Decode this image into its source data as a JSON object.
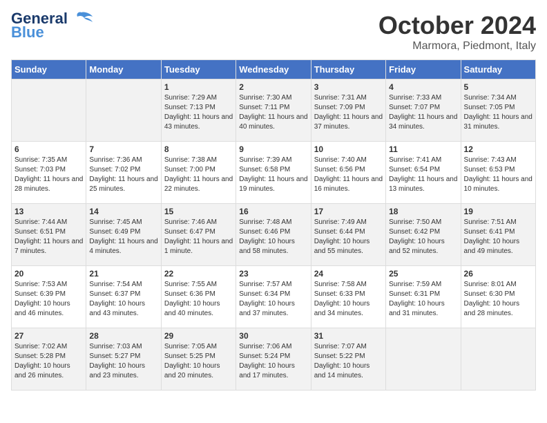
{
  "header": {
    "logo_general": "General",
    "logo_blue": "Blue",
    "month_title": "October 2024",
    "subtitle": "Marmora, Piedmont, Italy"
  },
  "weekdays": [
    "Sunday",
    "Monday",
    "Tuesday",
    "Wednesday",
    "Thursday",
    "Friday",
    "Saturday"
  ],
  "weeks": [
    [
      {
        "day": "",
        "info": ""
      },
      {
        "day": "",
        "info": ""
      },
      {
        "day": "1",
        "info": "Sunrise: 7:29 AM\nSunset: 7:13 PM\nDaylight: 11 hours and 43 minutes."
      },
      {
        "day": "2",
        "info": "Sunrise: 7:30 AM\nSunset: 7:11 PM\nDaylight: 11 hours and 40 minutes."
      },
      {
        "day": "3",
        "info": "Sunrise: 7:31 AM\nSunset: 7:09 PM\nDaylight: 11 hours and 37 minutes."
      },
      {
        "day": "4",
        "info": "Sunrise: 7:33 AM\nSunset: 7:07 PM\nDaylight: 11 hours and 34 minutes."
      },
      {
        "day": "5",
        "info": "Sunrise: 7:34 AM\nSunset: 7:05 PM\nDaylight: 11 hours and 31 minutes."
      }
    ],
    [
      {
        "day": "6",
        "info": "Sunrise: 7:35 AM\nSunset: 7:03 PM\nDaylight: 11 hours and 28 minutes."
      },
      {
        "day": "7",
        "info": "Sunrise: 7:36 AM\nSunset: 7:02 PM\nDaylight: 11 hours and 25 minutes."
      },
      {
        "day": "8",
        "info": "Sunrise: 7:38 AM\nSunset: 7:00 PM\nDaylight: 11 hours and 22 minutes."
      },
      {
        "day": "9",
        "info": "Sunrise: 7:39 AM\nSunset: 6:58 PM\nDaylight: 11 hours and 19 minutes."
      },
      {
        "day": "10",
        "info": "Sunrise: 7:40 AM\nSunset: 6:56 PM\nDaylight: 11 hours and 16 minutes."
      },
      {
        "day": "11",
        "info": "Sunrise: 7:41 AM\nSunset: 6:54 PM\nDaylight: 11 hours and 13 minutes."
      },
      {
        "day": "12",
        "info": "Sunrise: 7:43 AM\nSunset: 6:53 PM\nDaylight: 11 hours and 10 minutes."
      }
    ],
    [
      {
        "day": "13",
        "info": "Sunrise: 7:44 AM\nSunset: 6:51 PM\nDaylight: 11 hours and 7 minutes."
      },
      {
        "day": "14",
        "info": "Sunrise: 7:45 AM\nSunset: 6:49 PM\nDaylight: 11 hours and 4 minutes."
      },
      {
        "day": "15",
        "info": "Sunrise: 7:46 AM\nSunset: 6:47 PM\nDaylight: 11 hours and 1 minute."
      },
      {
        "day": "16",
        "info": "Sunrise: 7:48 AM\nSunset: 6:46 PM\nDaylight: 10 hours and 58 minutes."
      },
      {
        "day": "17",
        "info": "Sunrise: 7:49 AM\nSunset: 6:44 PM\nDaylight: 10 hours and 55 minutes."
      },
      {
        "day": "18",
        "info": "Sunrise: 7:50 AM\nSunset: 6:42 PM\nDaylight: 10 hours and 52 minutes."
      },
      {
        "day": "19",
        "info": "Sunrise: 7:51 AM\nSunset: 6:41 PM\nDaylight: 10 hours and 49 minutes."
      }
    ],
    [
      {
        "day": "20",
        "info": "Sunrise: 7:53 AM\nSunset: 6:39 PM\nDaylight: 10 hours and 46 minutes."
      },
      {
        "day": "21",
        "info": "Sunrise: 7:54 AM\nSunset: 6:37 PM\nDaylight: 10 hours and 43 minutes."
      },
      {
        "day": "22",
        "info": "Sunrise: 7:55 AM\nSunset: 6:36 PM\nDaylight: 10 hours and 40 minutes."
      },
      {
        "day": "23",
        "info": "Sunrise: 7:57 AM\nSunset: 6:34 PM\nDaylight: 10 hours and 37 minutes."
      },
      {
        "day": "24",
        "info": "Sunrise: 7:58 AM\nSunset: 6:33 PM\nDaylight: 10 hours and 34 minutes."
      },
      {
        "day": "25",
        "info": "Sunrise: 7:59 AM\nSunset: 6:31 PM\nDaylight: 10 hours and 31 minutes."
      },
      {
        "day": "26",
        "info": "Sunrise: 8:01 AM\nSunset: 6:30 PM\nDaylight: 10 hours and 28 minutes."
      }
    ],
    [
      {
        "day": "27",
        "info": "Sunrise: 7:02 AM\nSunset: 5:28 PM\nDaylight: 10 hours and 26 minutes."
      },
      {
        "day": "28",
        "info": "Sunrise: 7:03 AM\nSunset: 5:27 PM\nDaylight: 10 hours and 23 minutes."
      },
      {
        "day": "29",
        "info": "Sunrise: 7:05 AM\nSunset: 5:25 PM\nDaylight: 10 hours and 20 minutes."
      },
      {
        "day": "30",
        "info": "Sunrise: 7:06 AM\nSunset: 5:24 PM\nDaylight: 10 hours and 17 minutes."
      },
      {
        "day": "31",
        "info": "Sunrise: 7:07 AM\nSunset: 5:22 PM\nDaylight: 10 hours and 14 minutes."
      },
      {
        "day": "",
        "info": ""
      },
      {
        "day": "",
        "info": ""
      }
    ]
  ]
}
